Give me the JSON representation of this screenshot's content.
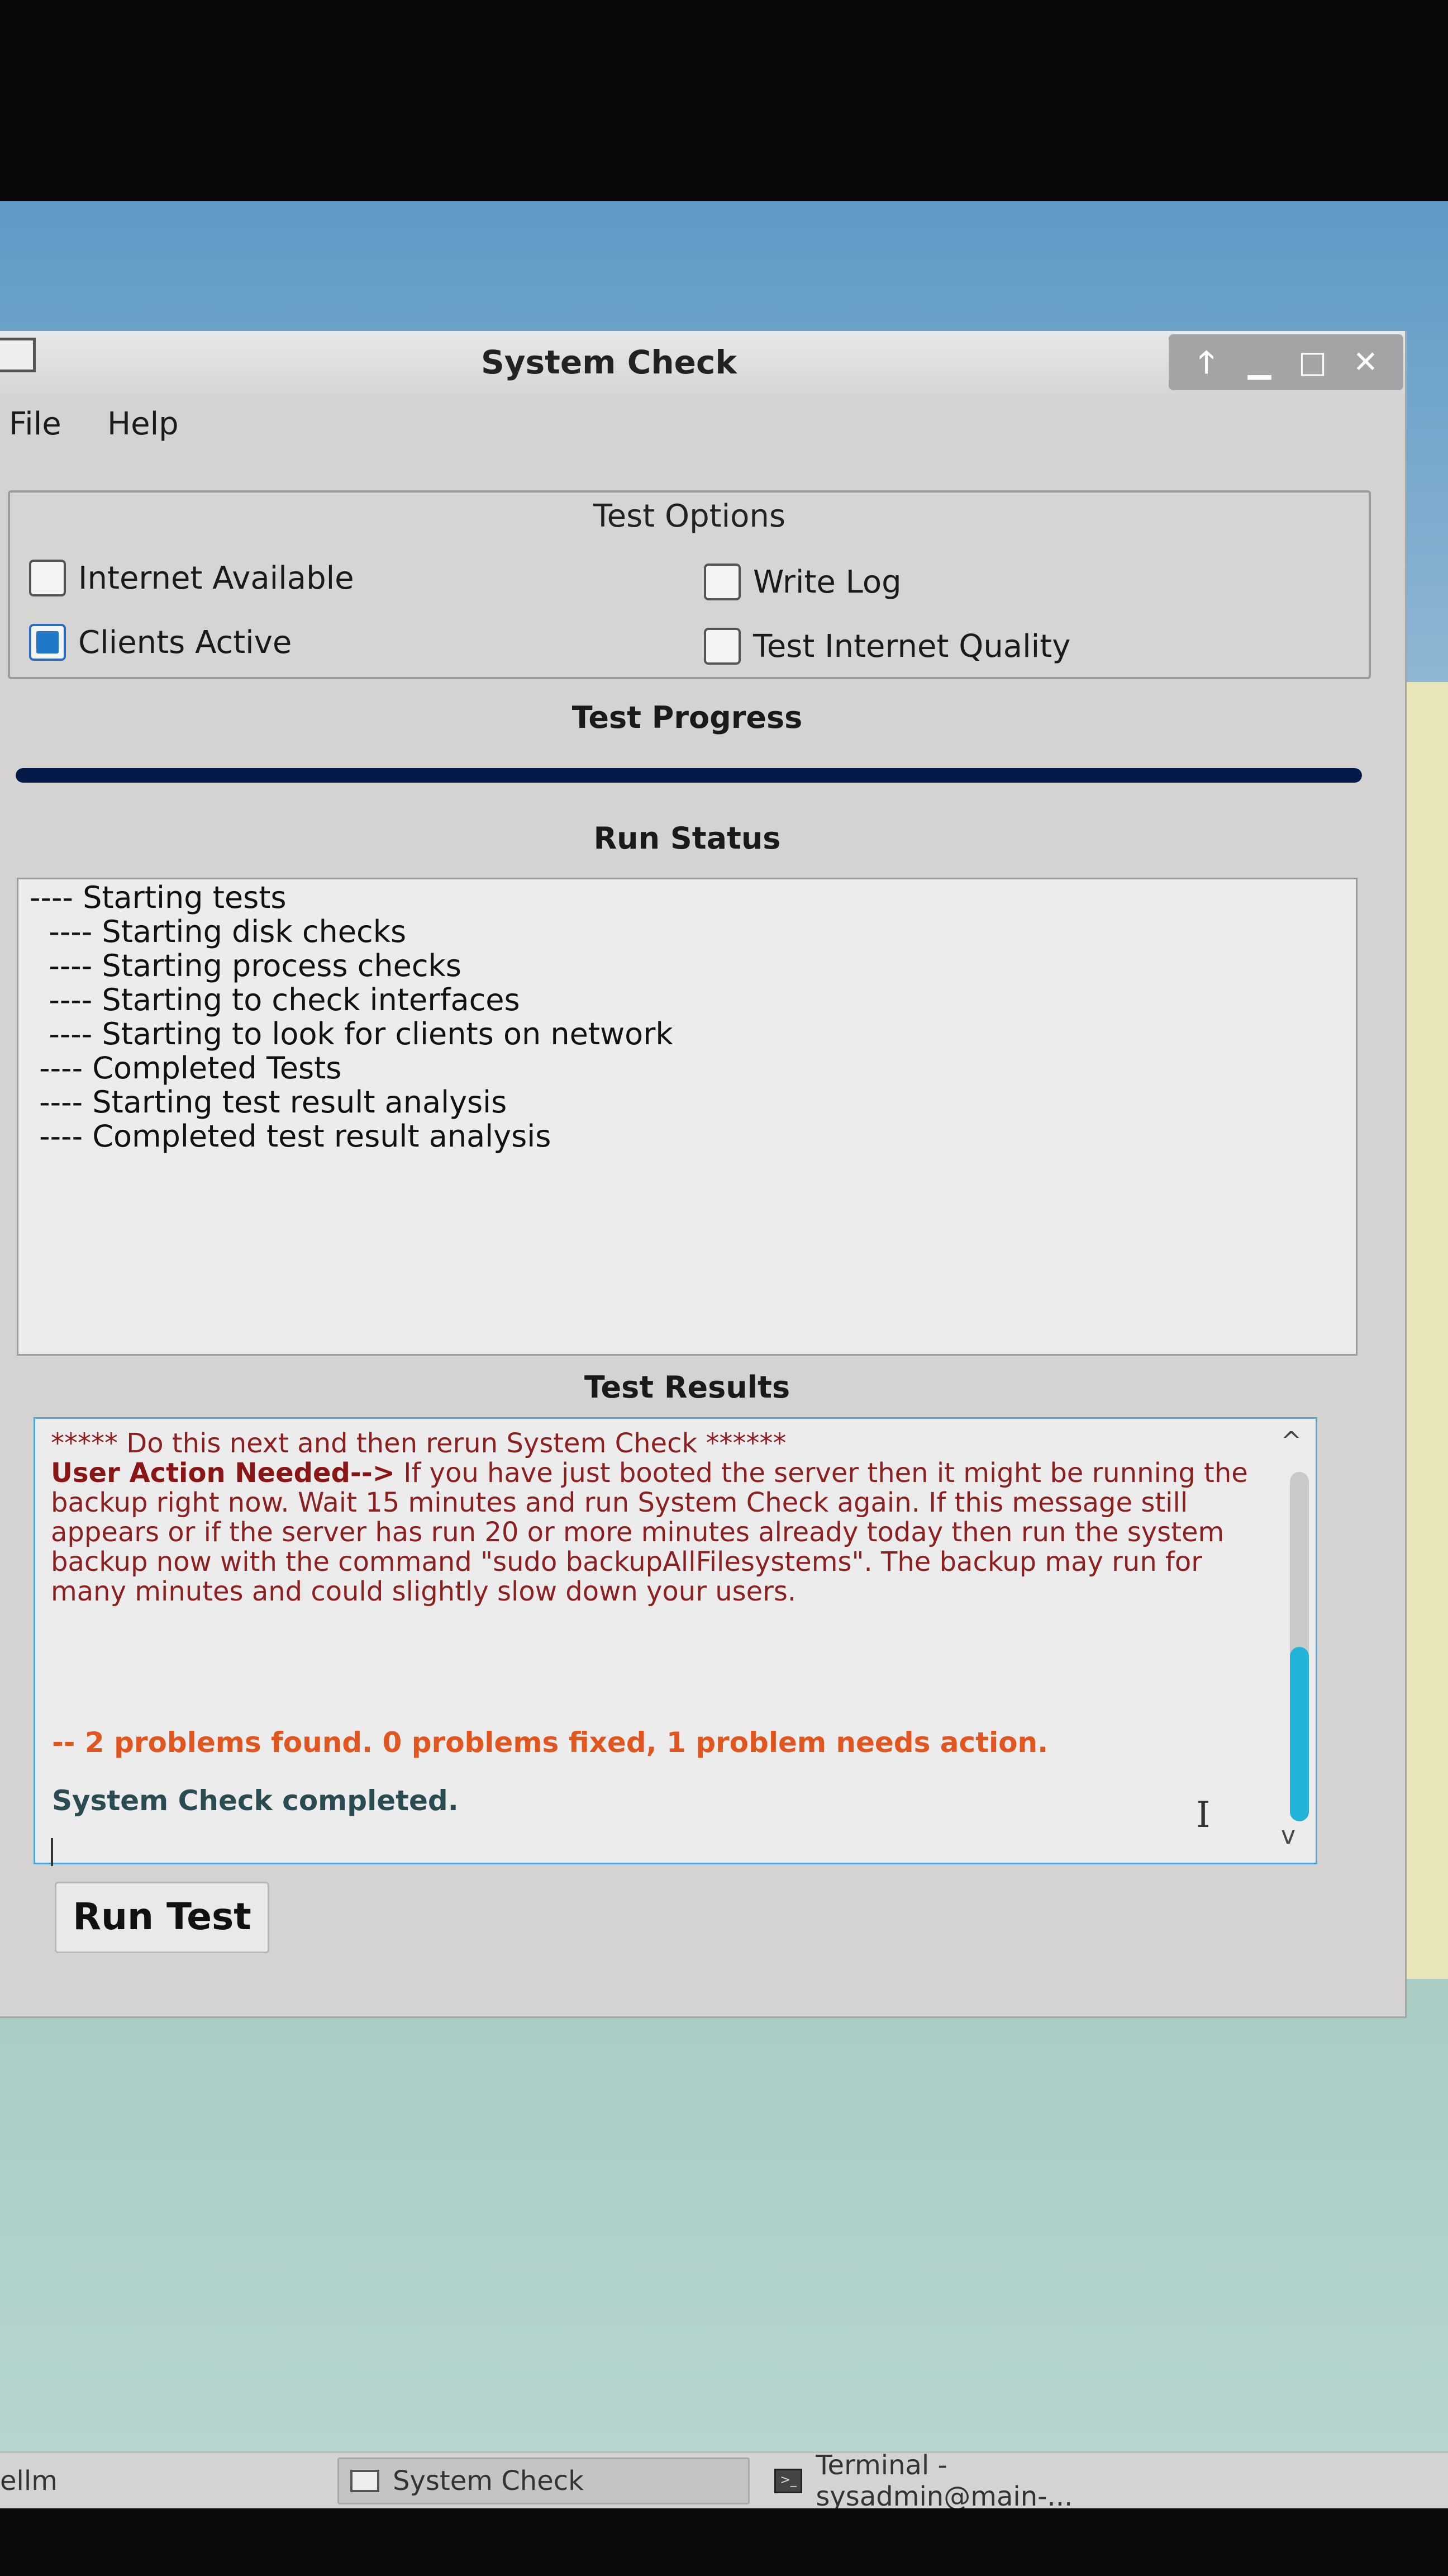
{
  "window": {
    "title": "System Check"
  },
  "window_controls": {
    "up": "🡑",
    "minimize": "▁",
    "maximize": "□",
    "close": "✕"
  },
  "menu": {
    "file": "File",
    "help": "Help"
  },
  "test_options": {
    "title": "Test Options",
    "internet_available": {
      "label": "Internet Available",
      "checked": false
    },
    "clients_active": {
      "label": "Clients Active",
      "checked": true
    },
    "write_log": {
      "label": "Write Log",
      "checked": false
    },
    "test_internet_quality": {
      "label": "Test Internet Quality",
      "checked": false
    }
  },
  "progress": {
    "label": "Test Progress",
    "value": 1.0
  },
  "run_status": {
    "label": "Run Status",
    "lines": [
      "---- Starting tests",
      "  ---- Starting disk checks",
      "  ---- Starting process checks",
      "  ---- Starting to check interfaces",
      "  ---- Starting to look for clients on network",
      " ---- Completed Tests",
      " ---- Starting test result analysis",
      " ---- Completed test result analysis"
    ]
  },
  "test_results": {
    "label": "Test Results",
    "header": "***** Do this next and then rerun System Check ******",
    "action_prefix": "User Action Needed-->",
    "action_text": " If you have just booted the server then it might be running the backup right now. Wait 15 minutes and run System Check again. If this message still appears or if the server has run 20 or more minutes already today then run the system backup now with the command \"sudo backupAllFilesystems\". The backup may run for many minutes and could slightly slow down your users.",
    "problems": "-- 2 problems found. 0 problems fixed, 1 problem needs action.",
    "completed": "System Check completed.",
    "scroll_up": "^",
    "scroll_down": "v"
  },
  "run_button": {
    "label": "Run Test"
  },
  "taskbar": {
    "left_item": "ellm",
    "system_check": "System Check",
    "terminal": "Terminal - sysadmin@main-..."
  },
  "colors": {
    "progress_fill": "#061a4a",
    "checkbox_checked": "#1f78c8",
    "results_border": "#4ea7d8",
    "problems_text": "#e0561e",
    "action_text": "#8c1f1f",
    "scroll_thumb": "#21b3d8"
  }
}
